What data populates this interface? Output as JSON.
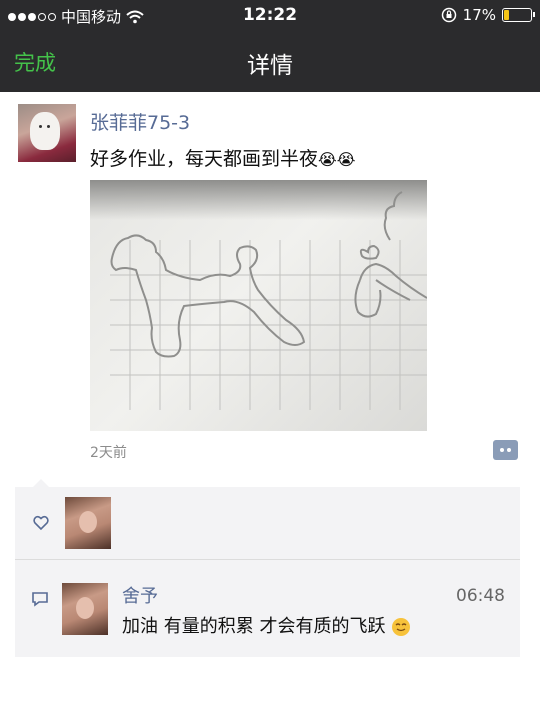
{
  "status_bar": {
    "carrier": "中国移动",
    "time": "12:22",
    "battery_percent": "17%",
    "battery_level": 0.17,
    "battery_color": "#f5c518"
  },
  "nav": {
    "done_label": "完成",
    "title": "详情",
    "done_color": "#44c24a"
  },
  "post": {
    "author": "张菲菲75-3",
    "text": "好多作业，每天都画到半夜",
    "emoji": "crying-face",
    "time_ago": "2天前",
    "link_color": "#576b95"
  },
  "likes": {
    "icon": "heart-outline-icon"
  },
  "comments": [
    {
      "author": "舍予",
      "time": "06:48",
      "text": "加油 有量的积累 才会有质的飞跃",
      "emoji": "smiling-face"
    }
  ]
}
